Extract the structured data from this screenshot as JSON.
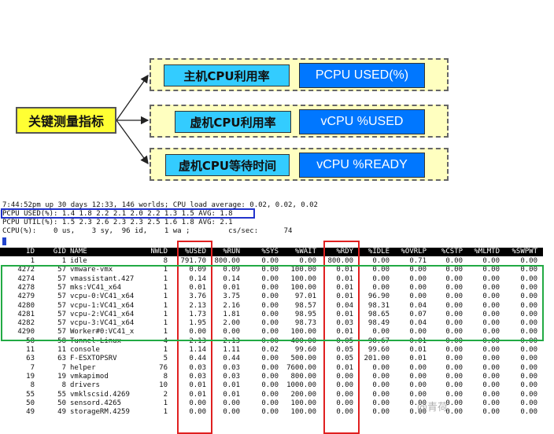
{
  "diagram": {
    "root": "关键测量指标",
    "branches": [
      {
        "cn": "主机CPU利用率",
        "en": "PCPU USED(%)"
      },
      {
        "cn": "虚机CPU利用率",
        "en": "vCPU %USED"
      },
      {
        "cn": "虚机CPU等待时间",
        "en": "vCPU %READY"
      }
    ]
  },
  "terminal": {
    "status_line": "7:44:52pm up 30 days 12:33, 146 worlds; CPU load average: 0.02, 0.02, 0.02",
    "pcpu_used": "PCPU USED(%): 1.4 1.8 2.2 2.1 2.0 2.2 1.3 1.5 AVG: 1.8",
    "pcpu_util": "PCPU UTIL(%): 1.5 2.3 2.6 2.3 2.3 2.5 1.6 1.8 AVG: 2.1",
    "ccpu": "CCPU(%):    0 us,    3 sy,  96 id,    1 wa ;         cs/sec:      74",
    "columns": [
      "ID",
      "GID",
      "NAME",
      "NWLD",
      "%USED",
      "%RUN",
      "%SYS",
      "%WAIT",
      "%RDY",
      "%IDLE",
      "%OVRLP",
      "%CSTP",
      "%MLMTD",
      "%SWPWT"
    ],
    "rows": [
      [
        "1",
        "1",
        "idle",
        "8",
        "791.70",
        "800.00",
        "0.00",
        "0.00",
        "800.00",
        "0.00",
        "0.71",
        "0.00",
        "0.00",
        "0.00"
      ],
      [
        "4272",
        "57",
        "vmware-vmx",
        "1",
        "0.09",
        "0.09",
        "0.00",
        "100.00",
        "0.01",
        "0.00",
        "0.00",
        "0.00",
        "0.00",
        "0.00"
      ],
      [
        "4274",
        "57",
        "vmassistant.427",
        "1",
        "0.14",
        "0.14",
        "0.00",
        "100.00",
        "0.01",
        "0.00",
        "0.00",
        "0.00",
        "0.00",
        "0.00"
      ],
      [
        "4278",
        "57",
        "mks:VC41_x64",
        "1",
        "0.01",
        "0.01",
        "0.00",
        "100.00",
        "0.01",
        "0.00",
        "0.00",
        "0.00",
        "0.00",
        "0.00"
      ],
      [
        "4279",
        "57",
        "vcpu-0:VC41_x64",
        "1",
        "3.76",
        "3.75",
        "0.00",
        "97.01",
        "0.01",
        "96.90",
        "0.00",
        "0.00",
        "0.00",
        "0.00"
      ],
      [
        "4280",
        "57",
        "vcpu-1:VC41_x64",
        "1",
        "2.13",
        "2.16",
        "0.00",
        "98.57",
        "0.04",
        "98.31",
        "0.04",
        "0.00",
        "0.00",
        "0.00"
      ],
      [
        "4281",
        "57",
        "vcpu-2:VC41_x64",
        "1",
        "1.73",
        "1.81",
        "0.00",
        "98.95",
        "0.01",
        "98.65",
        "0.07",
        "0.00",
        "0.00",
        "0.00"
      ],
      [
        "4282",
        "57",
        "vcpu-3:VC41_x64",
        "1",
        "1.95",
        "2.00",
        "0.00",
        "98.73",
        "0.03",
        "98.49",
        "0.04",
        "0.00",
        "0.00",
        "0.00"
      ],
      [
        "4290",
        "57",
        "Worker#0:VC41_x",
        "1",
        "0.00",
        "0.00",
        "0.00",
        "100.00",
        "0.01",
        "0.00",
        "0.00",
        "0.00",
        "0.00",
        "0.00"
      ],
      [
        "58",
        "58",
        "Tunnel-Linux",
        "4",
        "2.13",
        "2.13",
        "0.00",
        "400.00",
        "0.05",
        "98.67",
        "0.01",
        "0.00",
        "0.00",
        "0.00"
      ],
      [
        "11",
        "11",
        "console",
        "1",
        "1.14",
        "1.11",
        "0.02",
        "99.60",
        "0.05",
        "99.60",
        "0.01",
        "0.00",
        "0.00",
        "0.00"
      ],
      [
        "63",
        "63",
        "F-ESXTOPSRV",
        "5",
        "0.44",
        "0.44",
        "0.00",
        "500.00",
        "0.05",
        "201.00",
        "0.01",
        "0.00",
        "0.00",
        "0.00"
      ],
      [
        "7",
        "7",
        "helper",
        "76",
        "0.03",
        "0.03",
        "0.00",
        "7600.00",
        "0.01",
        "0.00",
        "0.00",
        "0.00",
        "0.00",
        "0.00"
      ],
      [
        "19",
        "19",
        "vmkapimod",
        "8",
        "0.03",
        "0.03",
        "0.00",
        "800.00",
        "0.00",
        "0.00",
        "0.00",
        "0.00",
        "0.00",
        "0.00"
      ],
      [
        "8",
        "8",
        "drivers",
        "10",
        "0.01",
        "0.01",
        "0.00",
        "1000.00",
        "0.00",
        "0.00",
        "0.00",
        "0.00",
        "0.00",
        "0.00"
      ],
      [
        "55",
        "55",
        "vmklscsid.4269",
        "2",
        "0.01",
        "0.01",
        "0.00",
        "200.00",
        "0.00",
        "0.00",
        "0.00",
        "0.00",
        "0.00",
        "0.00"
      ],
      [
        "50",
        "50",
        "sensord.4265",
        "1",
        "0.00",
        "0.00",
        "0.00",
        "100.00",
        "0.00",
        "0.00",
        "0.00",
        "0.00",
        "0.00",
        "0.00"
      ],
      [
        "49",
        "49",
        "storageRM.4259",
        "1",
        "0.00",
        "0.00",
        "0.00",
        "100.00",
        "0.00",
        "0.00",
        "0.00",
        "0.00",
        "0.00",
        "0.00"
      ]
    ]
  },
  "colors": {
    "root_fill": "#ffff33",
    "branch_fill": "#ffffc0",
    "cn_fill": "#33ccff",
    "en_fill": "#0077ff",
    "highlight_red": "#e02020",
    "highlight_green": "#22aa44",
    "highlight_blue": "#2233cc"
  },
  "watermark": "@青荷"
}
